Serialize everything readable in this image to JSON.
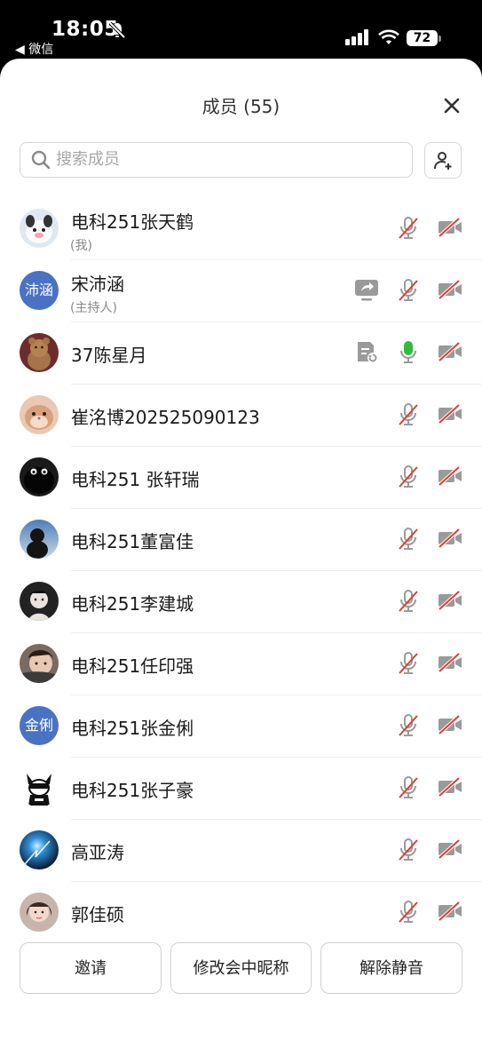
{
  "status_bar": {
    "time": "18:05",
    "back_app": "◀ 微信",
    "battery": "72"
  },
  "sheet": {
    "title": "成员 (55)"
  },
  "search": {
    "placeholder": "搜索成员"
  },
  "members": [
    {
      "name": "电科251张天鹤",
      "sub": "(我)",
      "avatar": "photo-dog",
      "mic": "muted",
      "cam": "off"
    },
    {
      "name": "宋沛涵",
      "sub": "(主持人)",
      "avatar_text": "沛涵",
      "avatar": "text",
      "share": true,
      "mic": "muted",
      "cam": "off"
    },
    {
      "name": "37陈星月",
      "avatar": "photo-bear",
      "doc": true,
      "mic": "on",
      "cam": "off"
    },
    {
      "name": "崔洺博202525090123",
      "avatar": "photo-hamster",
      "mic": "muted",
      "cam": "off"
    },
    {
      "name": "电科251 张轩瑞",
      "avatar": "photo-black-creature",
      "mic": "muted",
      "cam": "off"
    },
    {
      "name": "电科251董富佳",
      "avatar": "photo-hood",
      "mic": "muted",
      "cam": "off"
    },
    {
      "name": "电科251李建城",
      "avatar": "photo-dark",
      "mic": "muted",
      "cam": "off"
    },
    {
      "name": "电科251任印强",
      "avatar": "photo-selfie",
      "mic": "muted",
      "cam": "off"
    },
    {
      "name": "电科251张金俐",
      "avatar_text": "金俐",
      "avatar": "text",
      "mic": "muted",
      "cam": "off"
    },
    {
      "name": "电科251张子豪",
      "avatar": "photo-cartoon-dog",
      "mic": "muted",
      "cam": "off"
    },
    {
      "name": "高亚涛",
      "avatar": "photo-blue-spark",
      "mic": "muted",
      "cam": "off"
    },
    {
      "name": "郭佳硕",
      "avatar": "photo-girl",
      "mic": "muted",
      "cam": "off"
    }
  ],
  "buttons": {
    "invite": "邀请",
    "rename": "修改会中昵称",
    "unmute": "解除静音"
  },
  "colors": {
    "avatar_blue": "#4a72c4",
    "mic_active": "#2dbf3a",
    "muted_slash": "#e03c31"
  }
}
